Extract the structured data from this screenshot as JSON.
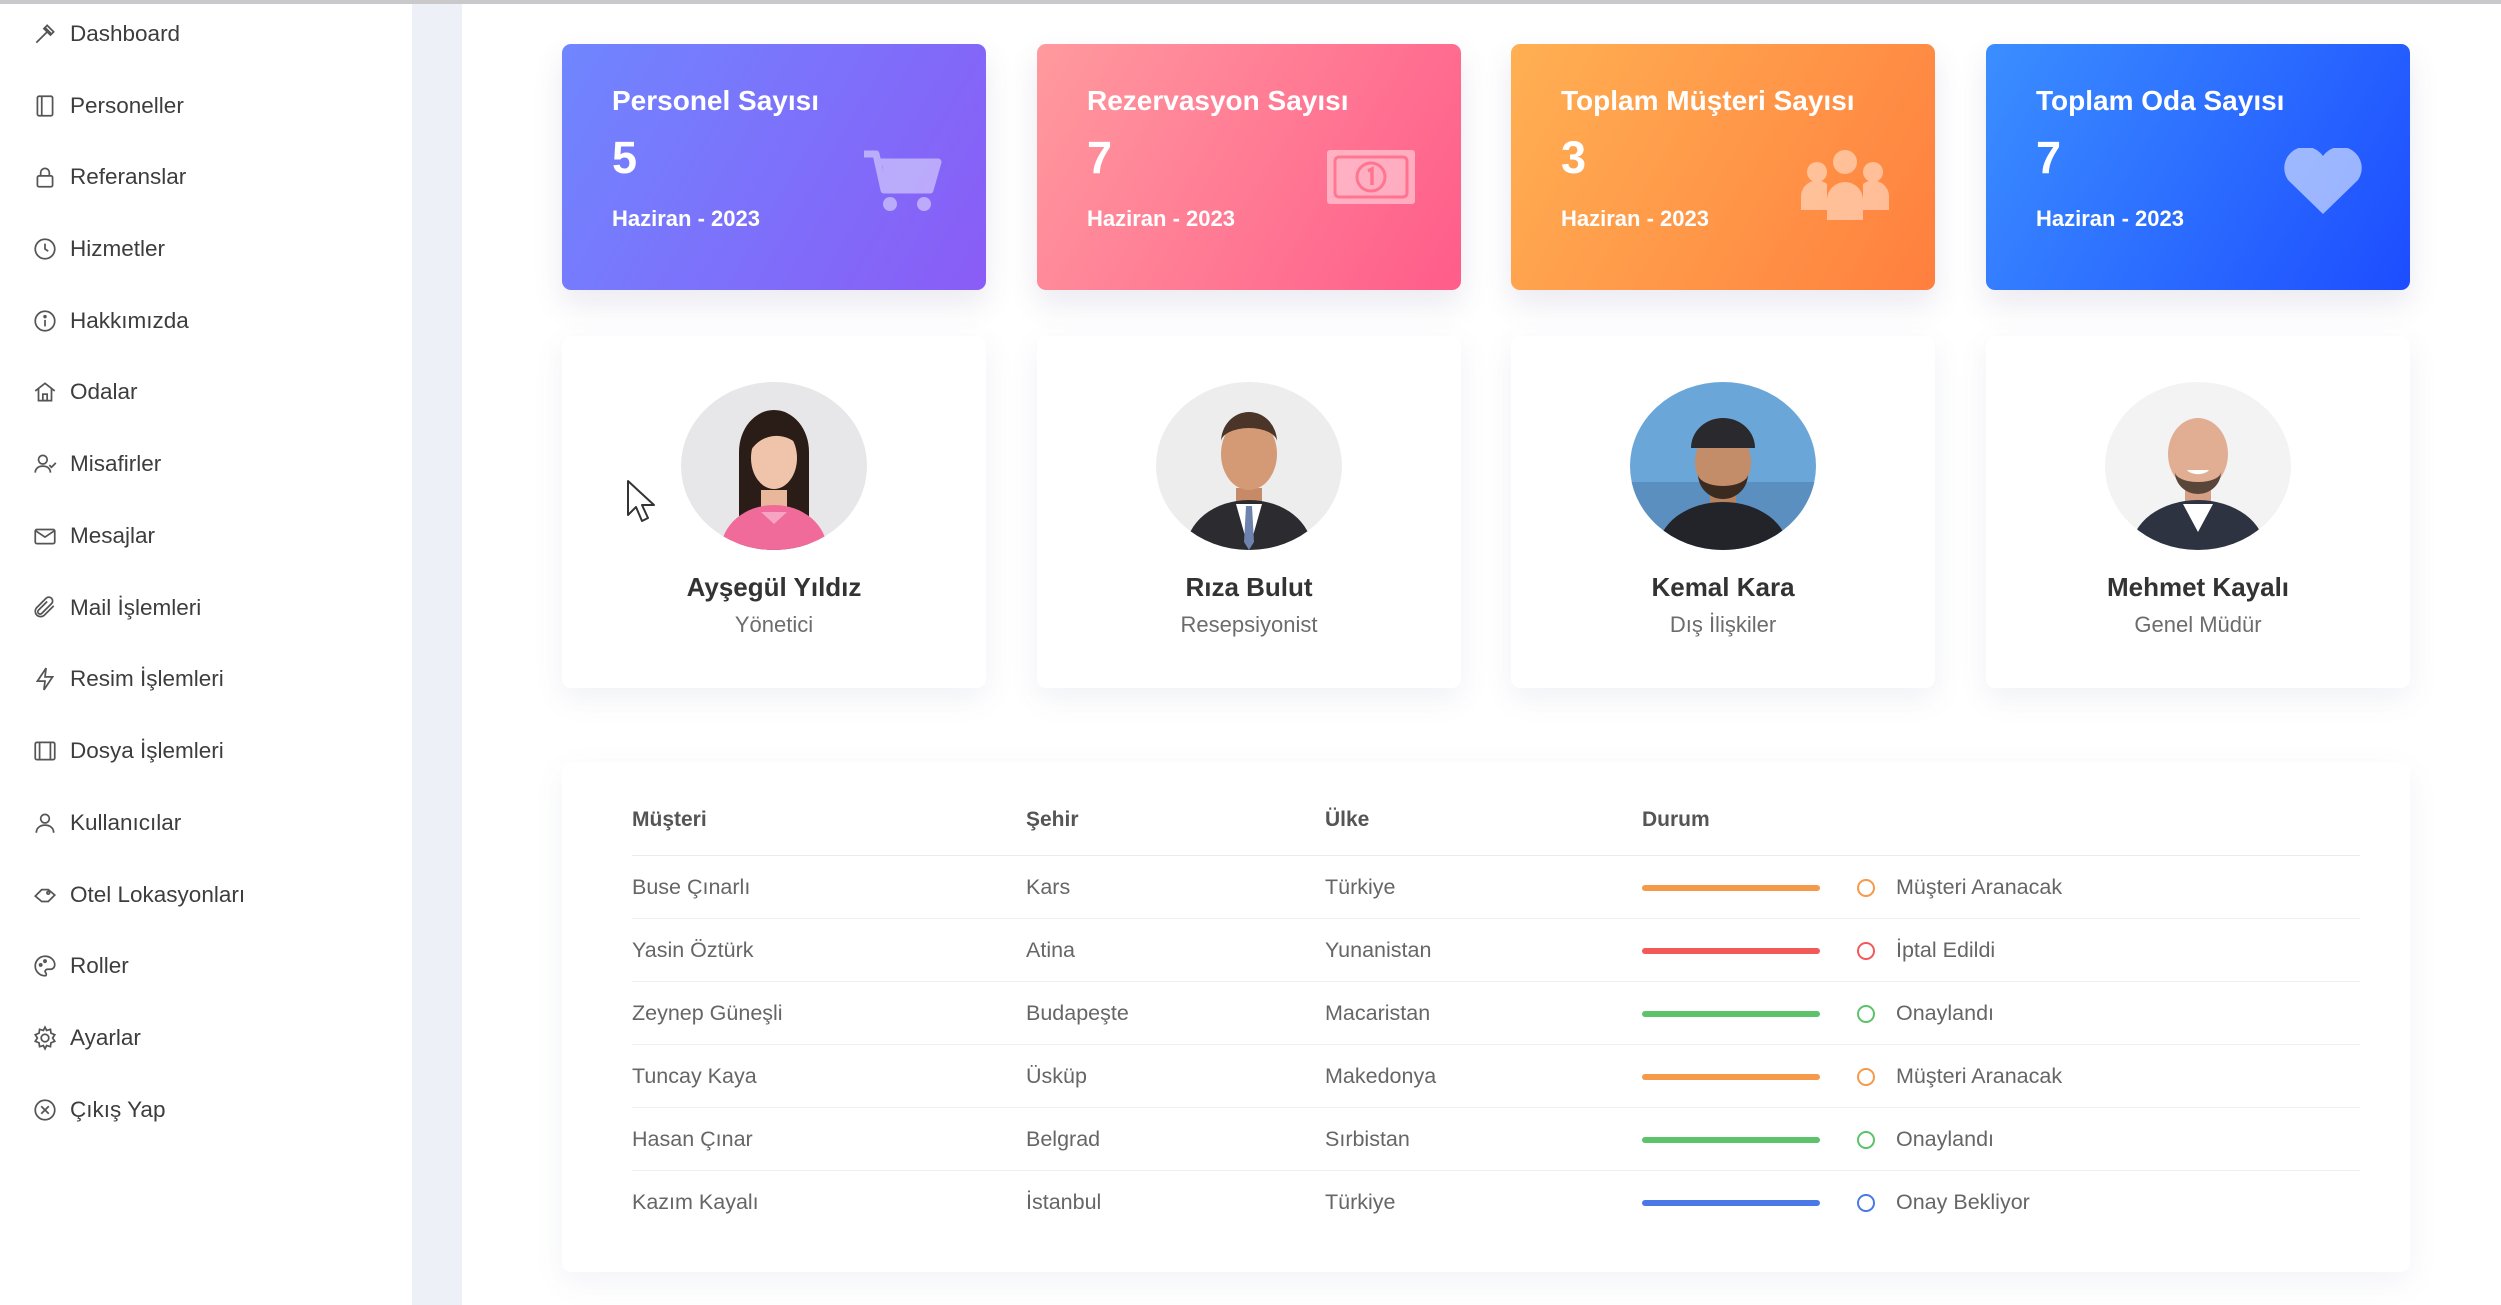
{
  "sidebar": {
    "items": [
      {
        "label": "Dashboard",
        "icon": "dashboard-icon"
      },
      {
        "label": "Personeller",
        "icon": "book-icon"
      },
      {
        "label": "Referanslar",
        "icon": "lock-icon"
      },
      {
        "label": "Hizmetler",
        "icon": "clock-icon"
      },
      {
        "label": "Hakkımızda",
        "icon": "info-icon"
      },
      {
        "label": "Odalar",
        "icon": "home-icon"
      },
      {
        "label": "Misafirler",
        "icon": "guests-icon"
      },
      {
        "label": "Mesajlar",
        "icon": "mail-icon"
      },
      {
        "label": "Mail İşlemleri",
        "icon": "paperclip-icon"
      },
      {
        "label": "Resim İşlemleri",
        "icon": "lightning-icon"
      },
      {
        "label": "Dosya İşlemleri",
        "icon": "film-icon"
      },
      {
        "label": "Kullanıcılar",
        "icon": "user-icon"
      },
      {
        "label": "Otel Lokasyonları",
        "icon": "hand-icon"
      },
      {
        "label": "Roller",
        "icon": "palette-icon"
      },
      {
        "label": "Ayarlar",
        "icon": "gear-icon"
      },
      {
        "label": "Çıkış Yap",
        "icon": "close-circle-icon"
      }
    ]
  },
  "stats": [
    {
      "title": "Personel Sayısı",
      "value": "5",
      "period": "Haziran - 2023",
      "icon": "cart-icon"
    },
    {
      "title": "Rezervasyon Sayısı",
      "value": "7",
      "period": "Haziran - 2023",
      "icon": "money-icon"
    },
    {
      "title": "Toplam Müşteri Sayısı",
      "value": "3",
      "period": "Haziran - 2023",
      "icon": "group-icon"
    },
    {
      "title": "Toplam Oda Sayısı",
      "value": "7",
      "period": "Haziran - 2023",
      "icon": "heart-icon"
    }
  ],
  "team": [
    {
      "name": "Ayşegül Yıldız",
      "role": "Yönetici"
    },
    {
      "name": "Rıza Bulut",
      "role": "Resepsiyonist"
    },
    {
      "name": "Kemal Kara",
      "role": "Dış İlişkiler"
    },
    {
      "name": "Mehmet Kayalı",
      "role": "Genel Müdür"
    }
  ],
  "table": {
    "headers": {
      "customer": "Müşteri",
      "city": "Şehir",
      "country": "Ülke",
      "status": "Durum"
    },
    "rows": [
      {
        "customer": "Buse Çınarlı",
        "city": "Kars",
        "country": "Türkiye",
        "status": "Müşteri Aranacak",
        "color": "#f59a4a"
      },
      {
        "customer": "Yasin Öztürk",
        "city": "Atina",
        "country": "Yunanistan",
        "status": "İptal Edildi",
        "color": "#f25a5a"
      },
      {
        "customer": "Zeynep Güneşli",
        "city": "Budapeşte",
        "country": "Macaristan",
        "status": "Onaylandı",
        "color": "#5cc36a"
      },
      {
        "customer": "Tuncay Kaya",
        "city": "Üsküp",
        "country": "Makedonya",
        "status": "Müşteri Aranacak",
        "color": "#f59a4a"
      },
      {
        "customer": "Hasan Çınar",
        "city": "Belgrad",
        "country": "Sırbistan",
        "status": "Onaylandı",
        "color": "#5cc36a"
      },
      {
        "customer": "Kazım Kayalı",
        "city": "İstanbul",
        "country": "Türkiye",
        "status": "Onay Bekliyor",
        "color": "#4a78e6"
      }
    ]
  }
}
